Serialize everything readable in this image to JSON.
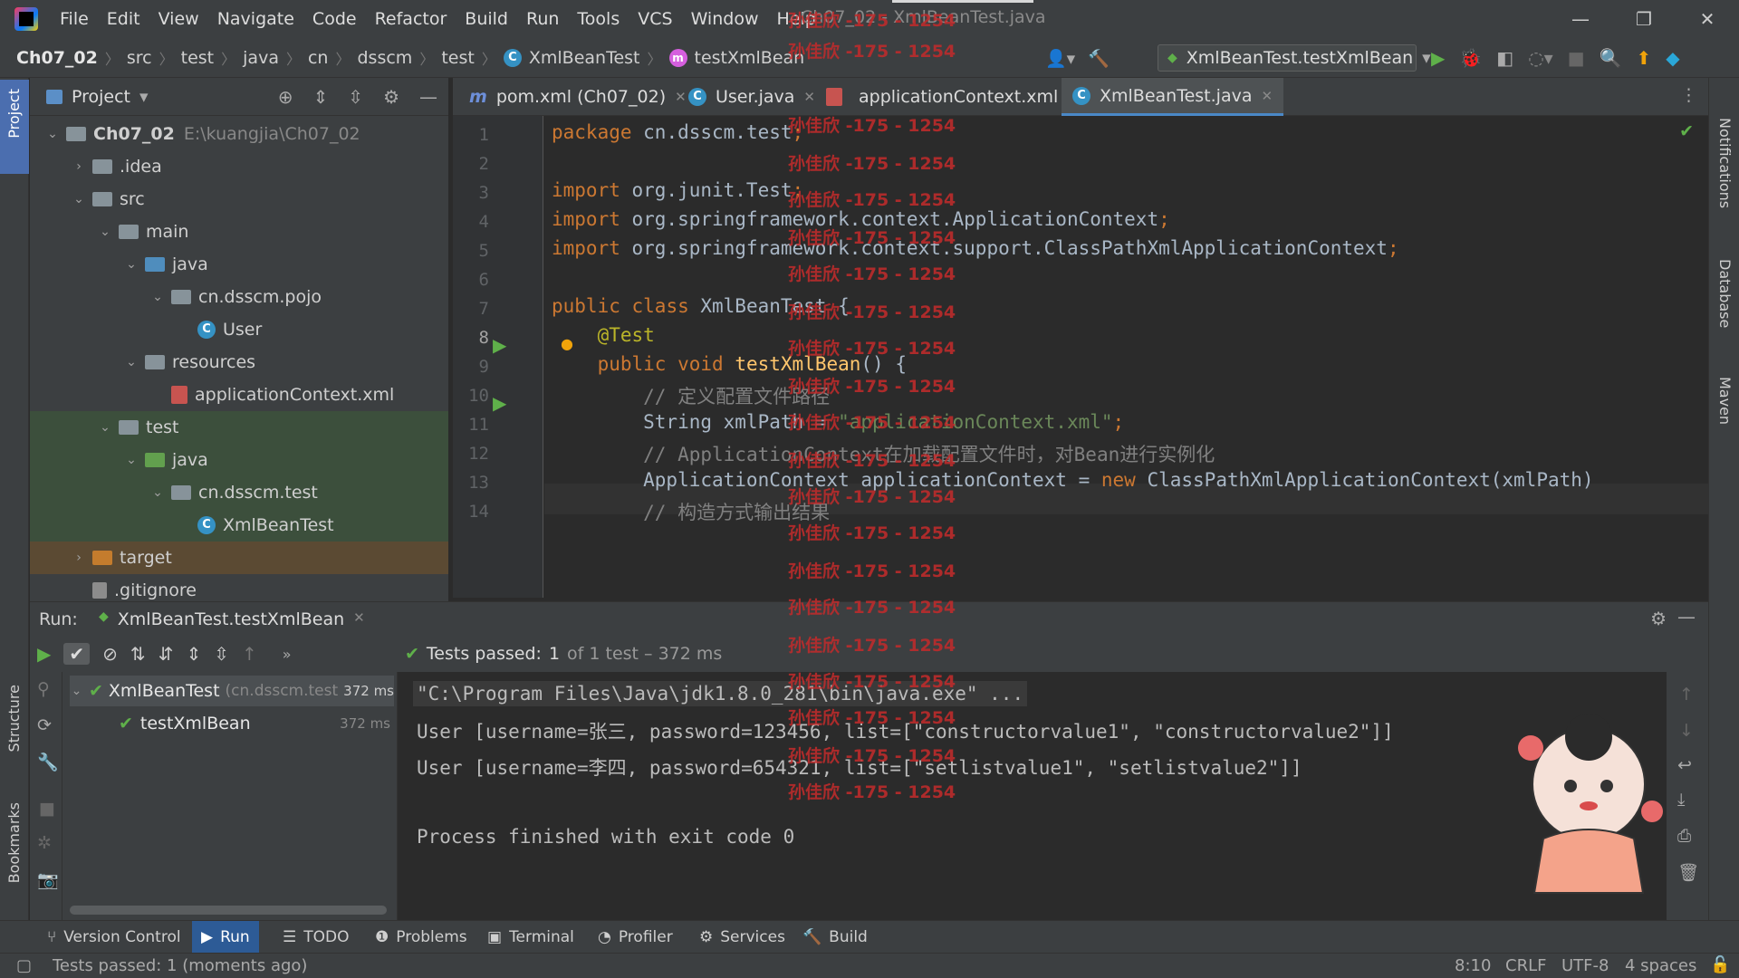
{
  "menu": {
    "items": [
      "File",
      "Edit",
      "View",
      "Navigate",
      "Code",
      "Refactor",
      "Build",
      "Run",
      "Tools",
      "VCS",
      "Window",
      "Help"
    ],
    "window_title": "Ch07_02 - XmlBeanTest.java"
  },
  "breadcrumbs": {
    "project": "Ch07_02",
    "parts": [
      "src",
      "test",
      "java",
      "cn",
      "dsscm",
      "test"
    ],
    "class": "XmlBeanTest",
    "method": "testXmlBean"
  },
  "run_config": {
    "label": "XmlBeanTest.testXmlBean"
  },
  "project_panel": {
    "title": "Project",
    "tree": [
      {
        "label": "Ch07_02",
        "extra": "E:\\kuangjia\\Ch07_02",
        "depth": 0,
        "arrow": "down",
        "kind": "proj"
      },
      {
        "label": ".idea",
        "depth": 1,
        "arrow": "right",
        "kind": "folder"
      },
      {
        "label": "src",
        "depth": 1,
        "arrow": "down",
        "kind": "folder"
      },
      {
        "label": "main",
        "depth": 2,
        "arrow": "down",
        "kind": "folder"
      },
      {
        "label": "java",
        "depth": 3,
        "arrow": "down",
        "kind": "blue"
      },
      {
        "label": "cn.dsscm.pojo",
        "depth": 4,
        "arrow": "down",
        "kind": "pkg"
      },
      {
        "label": "User",
        "depth": 5,
        "arrow": "",
        "kind": "class"
      },
      {
        "label": "resources",
        "depth": 3,
        "arrow": "down",
        "kind": "res"
      },
      {
        "label": "applicationContext.xml",
        "depth": 4,
        "arrow": "",
        "kind": "xml"
      },
      {
        "label": "test",
        "depth": 2,
        "arrow": "down",
        "kind": "folder"
      },
      {
        "label": "java",
        "depth": 3,
        "arrow": "down",
        "kind": "green"
      },
      {
        "label": "cn.dsscm.test",
        "depth": 4,
        "arrow": "down",
        "kind": "pkg"
      },
      {
        "label": "XmlBeanTest",
        "depth": 5,
        "arrow": "",
        "kind": "testclass"
      },
      {
        "label": "target",
        "depth": 1,
        "arrow": "right",
        "kind": "orange"
      },
      {
        "label": ".gitignore",
        "depth": 1,
        "arrow": "",
        "kind": "file"
      }
    ]
  },
  "editor_tabs": [
    {
      "label": "pom.xml (Ch07_02)",
      "icon": "maven-icon"
    },
    {
      "label": "User.java",
      "icon": "class-icon"
    },
    {
      "label": "applicationContext.xml",
      "icon": "xml-icon"
    },
    {
      "label": "XmlBeanTest.java",
      "icon": "test-class-icon",
      "active": true
    }
  ],
  "code": {
    "line_numbers": [
      "1",
      "2",
      "3",
      "4",
      "5",
      "6",
      "7",
      "8",
      "9",
      "10",
      "11",
      "12",
      "13",
      "14"
    ],
    "lines": [
      "package cn.dsscm.test;",
      "",
      "import org.junit.Test;",
      "import org.springframework.context.ApplicationContext;",
      "import org.springframework.context.support.ClassPathXmlApplicationContext;",
      "",
      "public class XmlBeanTest {",
      "    @Test",
      "    public void testXmlBean() {",
      "        // 定义配置文件路径",
      "        String xmlPath = \"applicationContext.xml\";",
      "        // ApplicationContext在加载配置文件时，对Bean进行实例化",
      "        ApplicationContext applicationContext = new ClassPathXmlApplicationContext(xmlPath)",
      "        // 构造方式输出结果"
    ]
  },
  "run": {
    "label": "Run:",
    "tab": "XmlBeanTest.testXmlBean",
    "status_prefix": "Tests passed:",
    "status_count": "1",
    "status_suffix": "of 1 test – 372 ms",
    "tree": [
      {
        "label": "XmlBeanTest",
        "pkg": "(cn.dsscm.test",
        "time": "372 ms"
      },
      {
        "label": "testXmlBean",
        "time": "372 ms"
      }
    ],
    "console": [
      "\"C:\\Program Files\\Java\\jdk1.8.0_281\\bin\\java.exe\" ...",
      "User [username=张三, password=123456, list=[\"constructorvalue1\", \"constructorvalue2\"]]",
      "User [username=李四, password=654321, list=[\"setlistvalue1\", \"setlistvalue2\"]]",
      "",
      "Process finished with exit code 0"
    ]
  },
  "bottom_tabs": [
    "Version Control",
    "Run",
    "TODO",
    "Problems",
    "Terminal",
    "Profiler",
    "Services",
    "Build"
  ],
  "status_bar": {
    "message": "Tests passed: 1 (moments ago)",
    "position": "8:10",
    "line_sep": "CRLF",
    "encoding": "UTF-8",
    "indent": "4 spaces"
  },
  "side_tabs": {
    "left": [
      "Project",
      "Structure",
      "Bookmarks"
    ],
    "right": [
      "Notifications",
      "Database",
      "Maven"
    ]
  },
  "watermark": "孙佳欣 -175 - 1254",
  "colors": {
    "accent": "#4a88c7",
    "pass": "#5fb04a",
    "watermark": "#c42b2b"
  }
}
